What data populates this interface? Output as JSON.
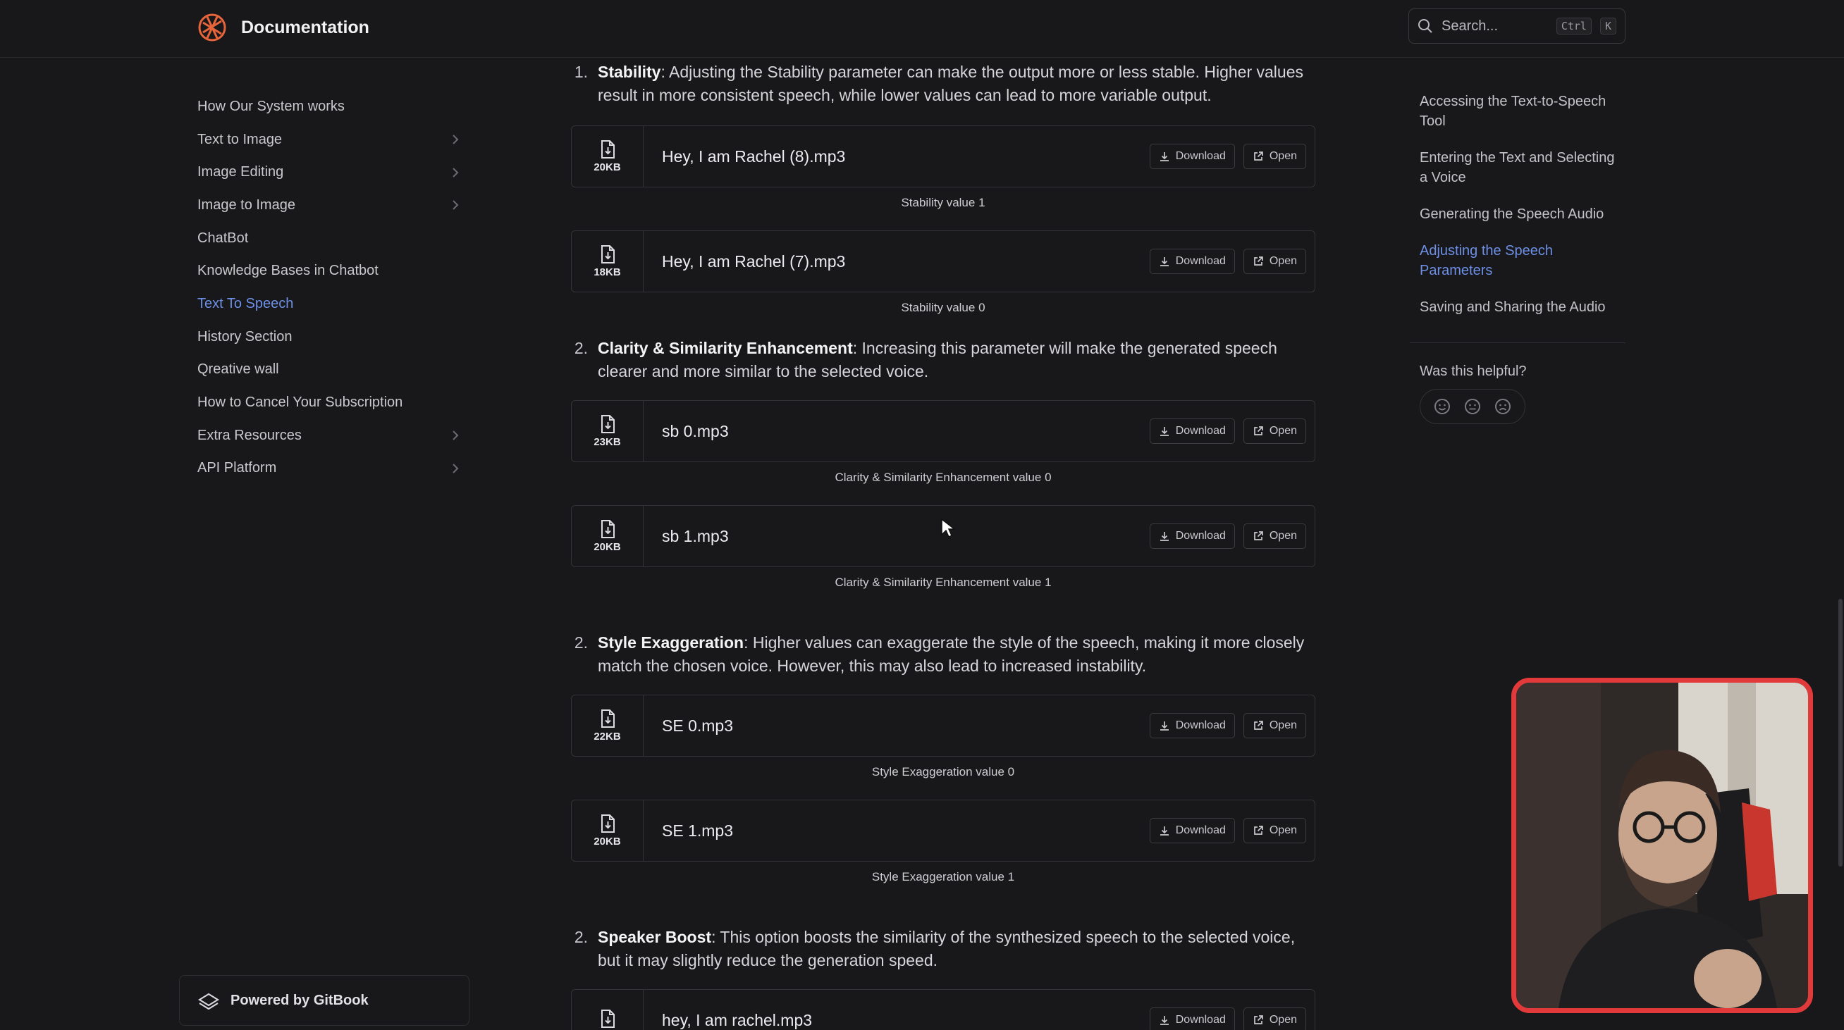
{
  "app": {
    "title": "Documentation"
  },
  "search": {
    "placeholder": "Search...",
    "shortcut_ctrl": "Ctrl",
    "shortcut_key": "K"
  },
  "sidebar": {
    "items": [
      {
        "label": "How Our System works",
        "has_children": false,
        "active": false
      },
      {
        "label": "Text to Image",
        "has_children": true,
        "active": false
      },
      {
        "label": "Image Editing",
        "has_children": true,
        "active": false
      },
      {
        "label": "Image to Image",
        "has_children": true,
        "active": false
      },
      {
        "label": "ChatBot",
        "has_children": false,
        "active": false
      },
      {
        "label": "Knowledge Bases in Chatbot",
        "has_children": false,
        "active": false
      },
      {
        "label": "Text To Speech",
        "has_children": false,
        "active": true
      },
      {
        "label": "History Section",
        "has_children": false,
        "active": false
      },
      {
        "label": "Qreative wall",
        "has_children": false,
        "active": false
      },
      {
        "label": "How to Cancel Your Subscription",
        "has_children": false,
        "active": false
      },
      {
        "label": "Extra Resources",
        "has_children": true,
        "active": false
      },
      {
        "label": "API Platform",
        "has_children": true,
        "active": false
      }
    ],
    "powered_by": "Powered by GitBook"
  },
  "main": {
    "buttons": {
      "download": "Download",
      "open": "Open"
    },
    "sections": [
      {
        "num": "1.",
        "term": "Stability",
        "text": ": Adjusting the Stability parameter can make the output more or less stable. Higher values result in more consistent speech, while lower values can lead to more variable output.",
        "files": [
          {
            "size": "20KB",
            "name": "Hey, I am Rachel (8).mp3",
            "caption": "Stability value 1"
          },
          {
            "size": "18KB",
            "name": "Hey, I am Rachel (7).mp3",
            "caption": "Stability value 0"
          }
        ]
      },
      {
        "num": "2.",
        "term": "Clarity & Similarity Enhancement",
        "text": ": Increasing this parameter will make the generated speech clearer and more similar to the selected voice.",
        "files": [
          {
            "size": "23KB",
            "name": "sb 0.mp3",
            "caption": "Clarity & Similarity Enhancement value 0"
          },
          {
            "size": "20KB",
            "name": "sb 1.mp3",
            "caption": "Clarity & Similarity Enhancement value 1"
          }
        ]
      },
      {
        "num": "2.",
        "term": "Style Exaggeration",
        "text": ": Higher values can exaggerate the style of the speech, making it more closely match the chosen voice. However, this may also lead to increased instability.",
        "files": [
          {
            "size": "22KB",
            "name": "SE 0.mp3",
            "caption": "Style Exaggeration value 0"
          },
          {
            "size": "20KB",
            "name": "SE 1.mp3",
            "caption": "Style Exaggeration value 1"
          }
        ]
      },
      {
        "num": "2.",
        "term": "Speaker Boost",
        "text": ": This option boosts the similarity of the synthesized speech to the selected voice, but it may slightly reduce the generation speed.",
        "files": [
          {
            "size": "",
            "name": "hey, I am rachel.mp3",
            "caption": ""
          }
        ]
      }
    ]
  },
  "toc": {
    "items": [
      {
        "label": "Accessing the Text-to-Speech Tool",
        "active": false
      },
      {
        "label": "Entering the Text and Selecting a Voice",
        "active": false
      },
      {
        "label": "Generating the Speech Audio",
        "active": false
      },
      {
        "label": "Adjusting the Speech Parameters",
        "active": true
      },
      {
        "label": "Saving and Sharing the Audio",
        "active": false
      }
    ],
    "helpful_label": "Was this helpful?"
  },
  "colors": {
    "background": "#18181a",
    "accent": "#6d8fe6",
    "webcam_border": "#e23a3a",
    "logo": "#e8643a"
  }
}
